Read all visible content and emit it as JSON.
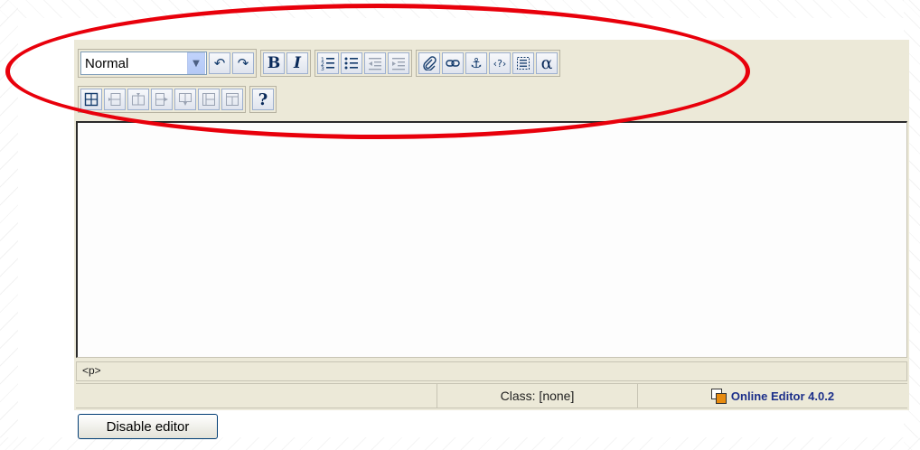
{
  "toolbar": {
    "format_select": {
      "value": "Normal"
    },
    "row1_buttons": [
      {
        "name": "undo-button",
        "icon": "undo-icon",
        "glyph": "↶"
      },
      {
        "name": "redo-button",
        "icon": "redo-icon",
        "glyph": "↷"
      },
      {
        "name": "bold-button",
        "icon": "bold-icon",
        "glyph": "B"
      },
      {
        "name": "italic-button",
        "icon": "italic-icon",
        "glyph": "I"
      },
      {
        "name": "ordered-list-button",
        "icon": "ordered-list-icon"
      },
      {
        "name": "unordered-list-button",
        "icon": "unordered-list-icon"
      },
      {
        "name": "outdent-button",
        "icon": "outdent-icon",
        "disabled": true
      },
      {
        "name": "indent-button",
        "icon": "indent-icon",
        "disabled": true
      },
      {
        "name": "attach-button",
        "icon": "paperclip-icon"
      },
      {
        "name": "link-button",
        "icon": "link-icon"
      },
      {
        "name": "anchor-button",
        "icon": "anchor-icon",
        "glyph": "⚓"
      },
      {
        "name": "abbreviation-button",
        "icon": "abbreviation-icon",
        "glyph": "‹?›"
      },
      {
        "name": "blockquote-button",
        "icon": "blockquote-icon"
      },
      {
        "name": "special-char-button",
        "icon": "alpha-icon",
        "glyph": "α"
      }
    ],
    "help_glyph": "?"
  },
  "path_bar": {
    "text": "<p>"
  },
  "status_bar": {
    "class_text": "Class: [none]",
    "brand_text": "Online Editor 4.0.2"
  },
  "disable_button": {
    "label": "Disable editor"
  },
  "colors": {
    "highlight": "#e8000b",
    "toolbar_bg": "#ece9d8",
    "brand": "#1c2f8a"
  }
}
